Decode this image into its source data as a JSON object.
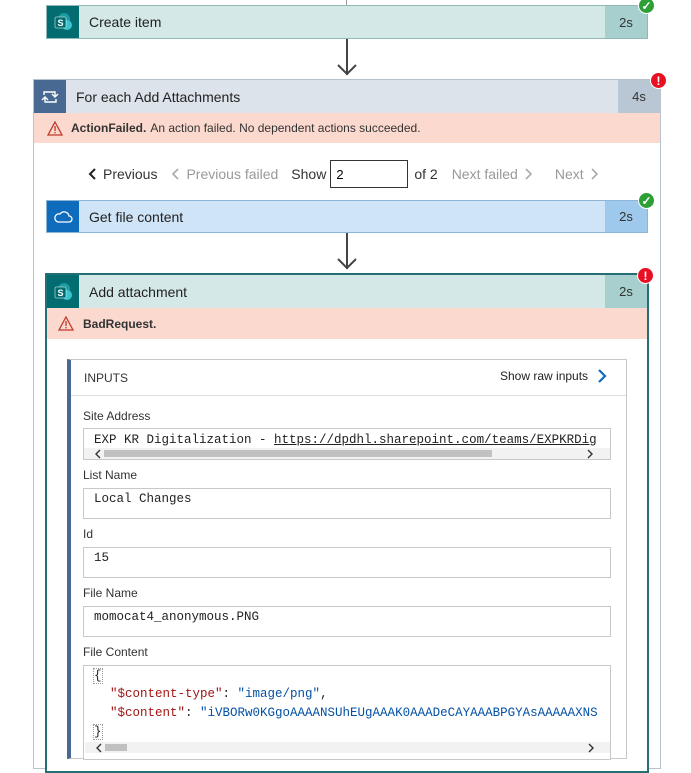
{
  "create_item": {
    "title": "Create item",
    "duration": "2s",
    "status": "success"
  },
  "foreach": {
    "title": "For each Add Attachments",
    "duration": "4s",
    "status": "error",
    "error_code": "ActionFailed.",
    "error_message": "An action failed. No dependent actions succeeded."
  },
  "pager": {
    "previous": "Previous",
    "previous_failed": "Previous failed",
    "show_label": "Show",
    "current": "2",
    "of_label": "of 2",
    "next_failed": "Next failed",
    "next": "Next"
  },
  "get_file": {
    "title": "Get file content",
    "duration": "2s",
    "status": "success"
  },
  "add_attachment": {
    "title": "Add attachment",
    "duration": "2s",
    "status": "error",
    "error_code": "BadRequest."
  },
  "inputs": {
    "heading": "INPUTS",
    "show_raw": "Show raw inputs",
    "site_address_label": "Site Address",
    "site_address_prefix": "EXP KR Digitalization - ",
    "site_address_link": "https://dpdhl.sharepoint.com/teams/EXPKRDig",
    "list_name_label": "List Name",
    "list_name_value": "Local Changes",
    "id_label": "Id",
    "id_value": "15",
    "file_name_label": "File Name",
    "file_name_value": "momocat4_anonymous.PNG",
    "file_content_label": "File Content",
    "json_open": "{",
    "json_key1": "\"$content-type\"",
    "json_val1": "\"image/png\"",
    "json_key2": "\"$content\"",
    "json_val2": "\"iVBORw0KGgoAAAANSUhEUgAAAK0AAADeCAYAAABPGYAsAAAAAXNS",
    "json_close": "}"
  },
  "colors": {
    "sharepoint_teal": "#036c70",
    "sharepoint_header": "#d3e8e7",
    "onedrive_blue": "#0f6cbd",
    "onedrive_header": "#cfe4f6",
    "control_header": "#dde3ea",
    "error_banner": "#fbd9ce"
  }
}
